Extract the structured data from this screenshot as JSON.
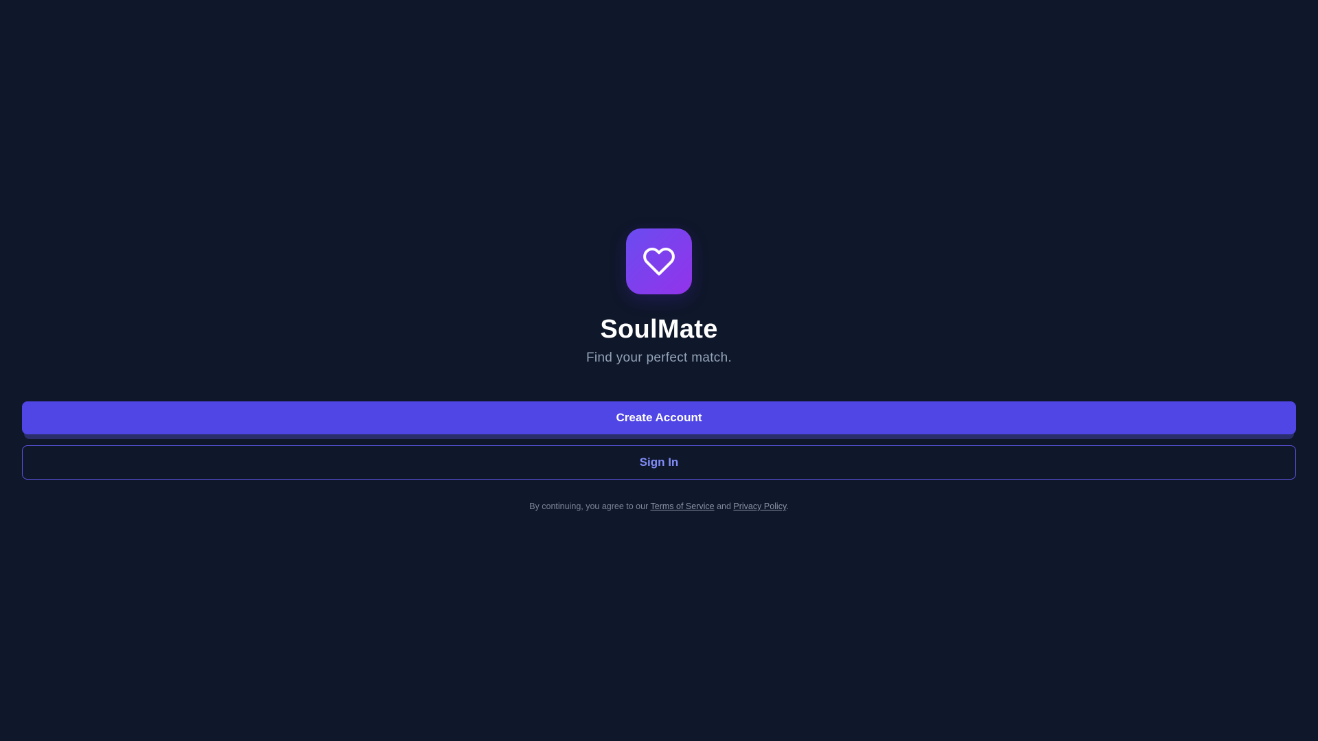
{
  "app": {
    "name": "SoulMate",
    "tagline": "Find your perfect match."
  },
  "logo": {
    "icon": "heart-icon",
    "gradient_start": "#6a4cf0",
    "gradient_end": "#9333ea"
  },
  "actions": {
    "create_account_label": "Create Account",
    "sign_in_label": "Sign In"
  },
  "legal": {
    "prefix": "By continuing, you agree to our ",
    "terms_label": "Terms of Service",
    "conjunction": " and ",
    "privacy_label": "Privacy Policy",
    "suffix": "."
  },
  "colors": {
    "background": "#0f172a",
    "primary": "#4f46e5",
    "secondary_text": "#818cf8",
    "muted_text": "#94a3b8"
  }
}
